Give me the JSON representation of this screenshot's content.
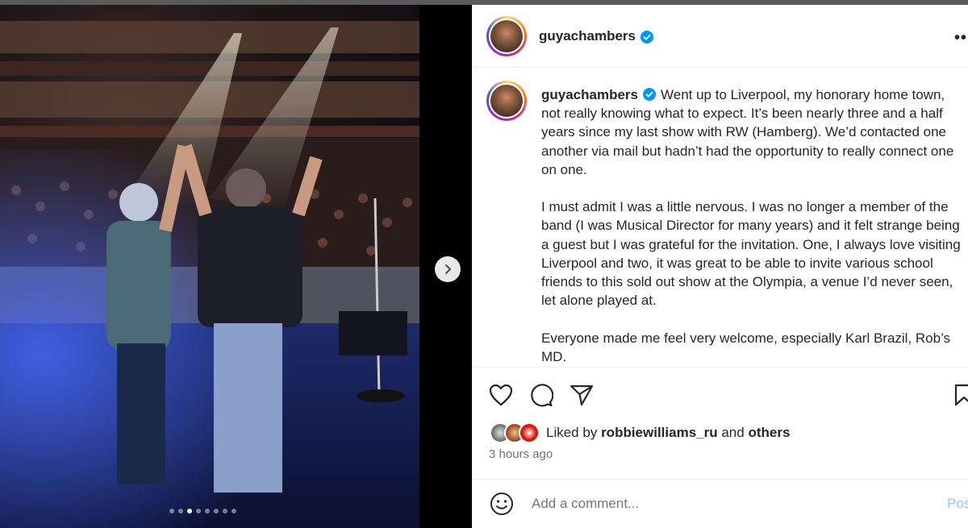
{
  "media": {
    "next_icon": "chevron-right-icon",
    "carousel_dots": 8,
    "active_dot": 2
  },
  "post": {
    "username": "guyachambers",
    "verified_icon": "verified-badge-icon",
    "more_icon": "ellipsis-icon"
  },
  "caption": {
    "username": "guyachambers",
    "paragraphs": [
      "Went up to Liverpool, my honorary home town, not really knowing what to expect. It’s been nearly three and a half years since my last show with RW (Hamberg). We’d contacted one another via mail but hadn’t had the opportunity to really connect one on one.",
      "I must admit I was a little nervous. I was no longer a member of the band (I was Musical Director for many years) and it felt strange being a guest but I was grateful for the invitation. One, I always love visiting Liverpool and two, it was great to be able to invite various school friends to this sold out show at the Olympia, a venue I’d never seen, let alone played at.",
      "Everyone made me feel very welcome, especially Karl Brazil, Rob’s MD."
    ]
  },
  "actions": {
    "like_icon": "heart-icon",
    "comment_icon": "comment-icon",
    "share_icon": "send-icon",
    "save_icon": "bookmark-icon"
  },
  "likes": {
    "prefix": "Liked by",
    "user": "robbiewilliams_ru",
    "and": "and",
    "others": "others"
  },
  "timestamp": "3 hours ago",
  "comment": {
    "placeholder": "Add a comment...",
    "emoji_icon": "smiley-icon",
    "post_label": "Post"
  },
  "colors": {
    "verified": "#0095f6",
    "post_button": "#8fc3f7",
    "text": "#262626",
    "muted": "#737373"
  }
}
